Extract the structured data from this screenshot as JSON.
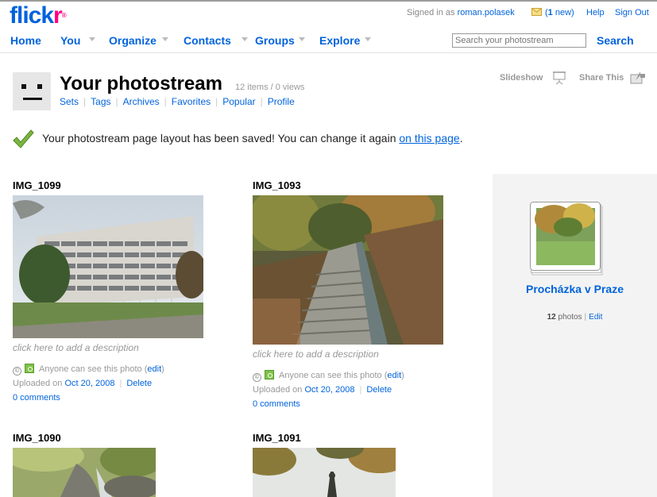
{
  "brand": {
    "logo_fl": "flick",
    "logo_r": "r",
    "logo_reg": "®"
  },
  "header": {
    "signed_in_prefix": "Signed in as",
    "username": "roman.polasek",
    "mail_new_count": "1",
    "mail_new_suffix": "new",
    "help": "Help",
    "sign_out": "Sign Out",
    "search_placeholder": "Search your photostream",
    "search_button": "Search"
  },
  "nav": [
    {
      "label": "Home"
    },
    {
      "label": "You"
    },
    {
      "label": "Organize"
    },
    {
      "label": "Contacts"
    },
    {
      "label": "Groups"
    },
    {
      "label": "Explore"
    }
  ],
  "page": {
    "title": "Your photostream",
    "counts": "12 items / 0 views",
    "subnav": [
      "Sets",
      "Tags",
      "Archives",
      "Favorites",
      "Popular",
      "Profile"
    ],
    "slideshow": "Slideshow",
    "share": "Share This"
  },
  "message": {
    "text": "Your photostream page layout has been saved! You can change it again",
    "link": "on this page",
    "end": "."
  },
  "photos": [
    {
      "title": "IMG_1099",
      "description_placeholder": "click here to add a description",
      "privacy": "Anyone can see this photo",
      "privacy_edit": "edit",
      "uploaded_prefix": "Uploaded on",
      "uploaded_date": "Oct 20, 2008",
      "delete": "Delete",
      "comments": "0 comments"
    },
    {
      "title": "IMG_1093",
      "description_placeholder": "click here to add a description",
      "privacy": "Anyone can see this photo",
      "privacy_edit": "edit",
      "uploaded_prefix": "Uploaded on",
      "uploaded_date": "Oct 20, 2008",
      "delete": "Delete",
      "comments": "0 comments"
    },
    {
      "title": "IMG_1090"
    },
    {
      "title": "IMG_1091"
    }
  ],
  "sidebar": {
    "set_title": "Procházka v Praze",
    "photo_count": "12",
    "photos_label": "photos",
    "edit": "Edit"
  }
}
